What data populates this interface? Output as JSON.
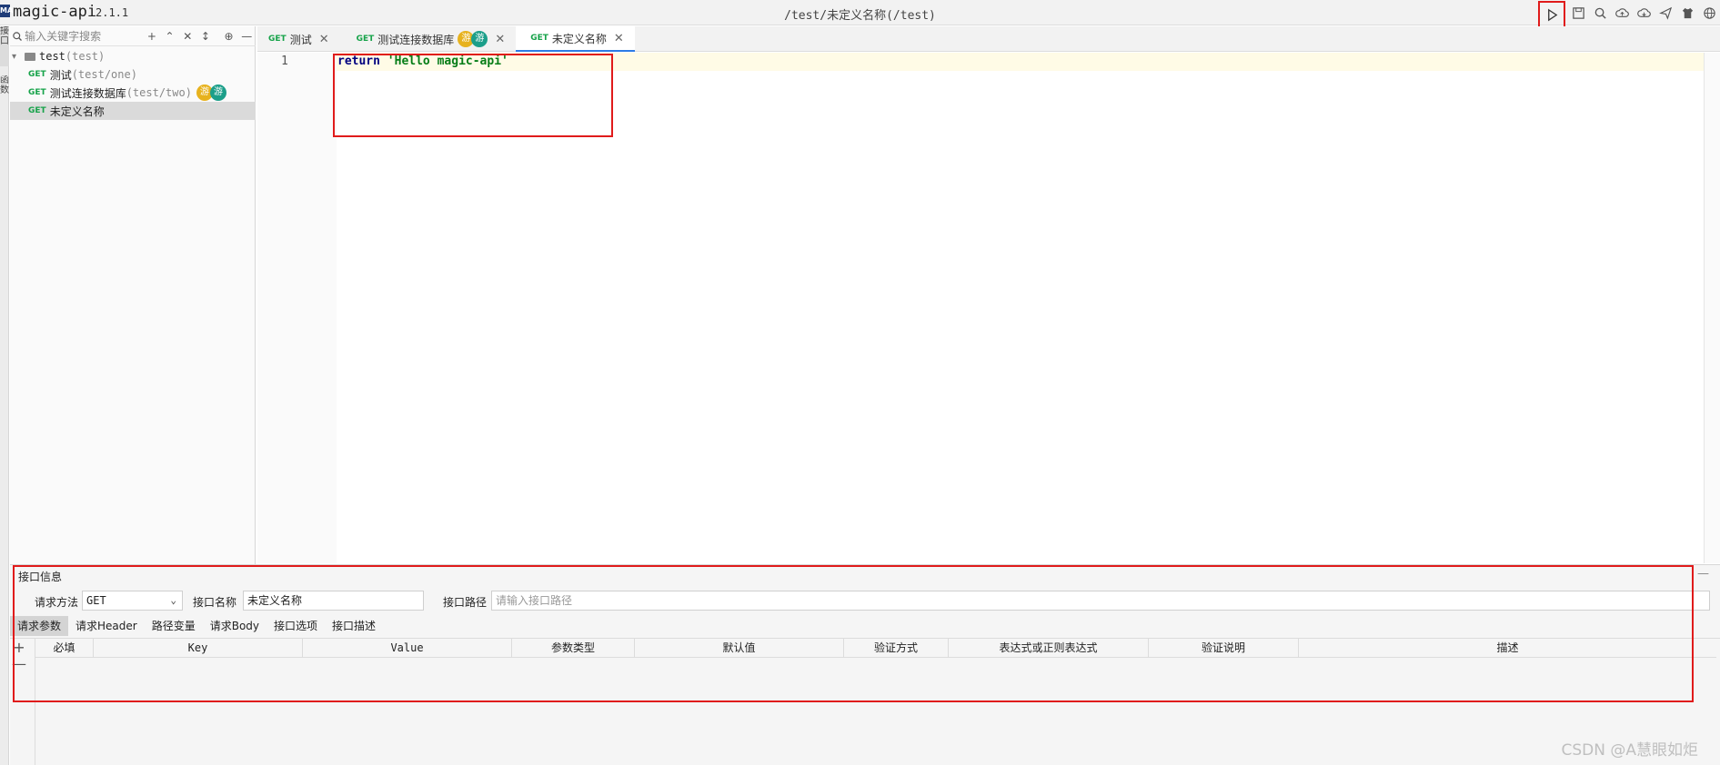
{
  "app": {
    "name": "magic-api",
    "version": "2.1.1",
    "current_path": "/test/未定义名称(/test)",
    "logo_text": "MA"
  },
  "toolbar": {
    "icons": [
      "run-icon",
      "save-icon",
      "search-icon",
      "upload-icon",
      "cloud-download-icon",
      "push-icon",
      "skin-icon",
      "language-icon"
    ]
  },
  "left_rail": {
    "tabs": [
      "接口",
      "函数"
    ]
  },
  "sidebar": {
    "search_placeholder": "输入关键字搜索",
    "tools": [
      "+",
      "⌃",
      "✕",
      "↕",
      "⊕",
      "—"
    ],
    "tree": [
      {
        "type": "group",
        "name": "test",
        "path": "(test)"
      },
      {
        "type": "api",
        "method": "GET",
        "name": "测试",
        "path": "(test/one)",
        "badges": []
      },
      {
        "type": "api",
        "method": "GET",
        "name": "测试连接数据库",
        "path": "(test/two)",
        "badges": [
          "游",
          "游"
        ]
      },
      {
        "type": "api",
        "method": "GET",
        "name": "未定义名称",
        "path": "",
        "badges": [],
        "selected": true
      }
    ]
  },
  "editor": {
    "tabs": [
      {
        "method": "GET",
        "name": "测试",
        "close": "✕"
      },
      {
        "method": "GET",
        "name": "测试连接数据库",
        "close": "✕",
        "badges": [
          "游",
          "游"
        ]
      },
      {
        "method": "GET",
        "name": "未定义名称",
        "close": "✕",
        "active": true
      }
    ],
    "line_number": "1",
    "code_keyword": "return",
    "code_string": "'Hello magic-api'"
  },
  "panel": {
    "title": "接口信息",
    "collapse": "—",
    "method_label": "请求方法",
    "method_value": "GET",
    "name_label": "接口名称",
    "name_value": "未定义名称",
    "path_label": "接口路径",
    "path_placeholder": "请输入接口路径",
    "tabs": [
      "请求参数",
      "请求Header",
      "路径变量",
      "请求Body",
      "接口选项",
      "接口描述"
    ],
    "add": "+",
    "remove": "—",
    "columns": [
      "必填",
      "Key",
      "Value",
      "参数类型",
      "默认值",
      "验证方式",
      "表达式或正则表达式",
      "验证说明",
      "描述"
    ]
  },
  "watermark": "CSDN @A慧眼如炬",
  "colors": {
    "accent": "#2d7be5",
    "method_get": "#17a34a",
    "highlight": "#e01b1b"
  }
}
